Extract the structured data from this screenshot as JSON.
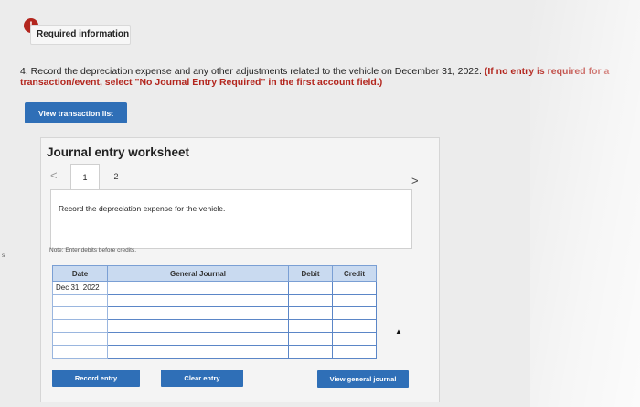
{
  "header": {
    "info_icon_glyph": "!",
    "required_label": "Required information"
  },
  "question": {
    "number_and_text": "4. Record the depreciation expense and any other adjustments related to the vehicle on December 31, 2022.",
    "instruction": "(If no entry is required for a transaction/event, select \"No Journal Entry Required\" in the first account field.)"
  },
  "buttons": {
    "view_transaction_list": "View transaction list",
    "record_entry": "Record entry",
    "clear_entry": "Clear entry",
    "view_general_journal": "View general journal"
  },
  "worksheet": {
    "title": "Journal entry worksheet",
    "prev_glyph": "<",
    "next_glyph": ">",
    "tabs": [
      "1",
      "2"
    ],
    "description": "Record the depreciation expense for the vehicle.",
    "note": "Note: Enter debits before credits."
  },
  "table": {
    "headers": {
      "date": "Date",
      "account": "General Journal",
      "debit": "Debit",
      "credit": "Credit"
    },
    "rows": [
      {
        "date": "Dec 31, 2022",
        "account": "",
        "debit": "",
        "credit": ""
      },
      {
        "date": "",
        "account": "",
        "debit": "",
        "credit": ""
      },
      {
        "date": "",
        "account": "",
        "debit": "",
        "credit": ""
      },
      {
        "date": "",
        "account": "",
        "debit": "",
        "credit": ""
      },
      {
        "date": "",
        "account": "",
        "debit": "",
        "credit": ""
      },
      {
        "date": "",
        "account": "",
        "debit": "",
        "credit": ""
      }
    ]
  },
  "misc": {
    "edge_text": "s",
    "cursor_glyph": "▲"
  },
  "colors": {
    "button_blue": "#2f6fb7",
    "header_blue": "#c9daf0",
    "info_red": "#b3261e"
  }
}
